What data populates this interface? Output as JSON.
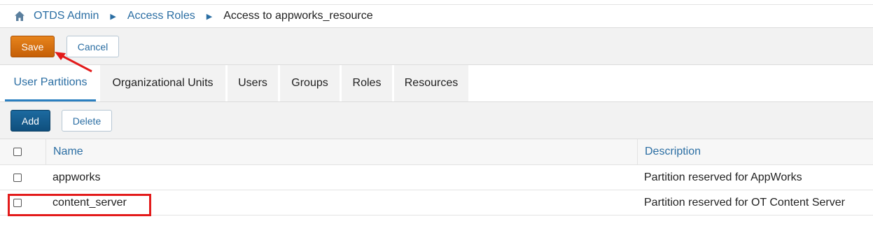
{
  "breadcrumb": {
    "home_icon": "home-icon",
    "items": [
      "OTDS Admin",
      "Access Roles"
    ],
    "separator_icon": "triangle-right-icon",
    "current": "Access to appworks_resource"
  },
  "toolbar": {
    "save_label": "Save",
    "cancel_label": "Cancel"
  },
  "tabs": [
    {
      "label": "User Partitions",
      "active": true
    },
    {
      "label": "Organizational Units",
      "active": false
    },
    {
      "label": "Users",
      "active": false
    },
    {
      "label": "Groups",
      "active": false
    },
    {
      "label": "Roles",
      "active": false
    },
    {
      "label": "Resources",
      "active": false
    }
  ],
  "subbar": {
    "add_label": "Add",
    "delete_label": "Delete"
  },
  "table": {
    "columns": [
      "Name",
      "Description"
    ],
    "rows": [
      {
        "name": "appworks",
        "description": "Partition reserved for AppWorks"
      },
      {
        "name": "content_server",
        "description": "Partition reserved for OT Content Server"
      }
    ]
  },
  "colors": {
    "accent": "#2b6ea3",
    "save_button": "#d9730f",
    "add_button": "#15598a",
    "annotation": "#e31b1b"
  }
}
